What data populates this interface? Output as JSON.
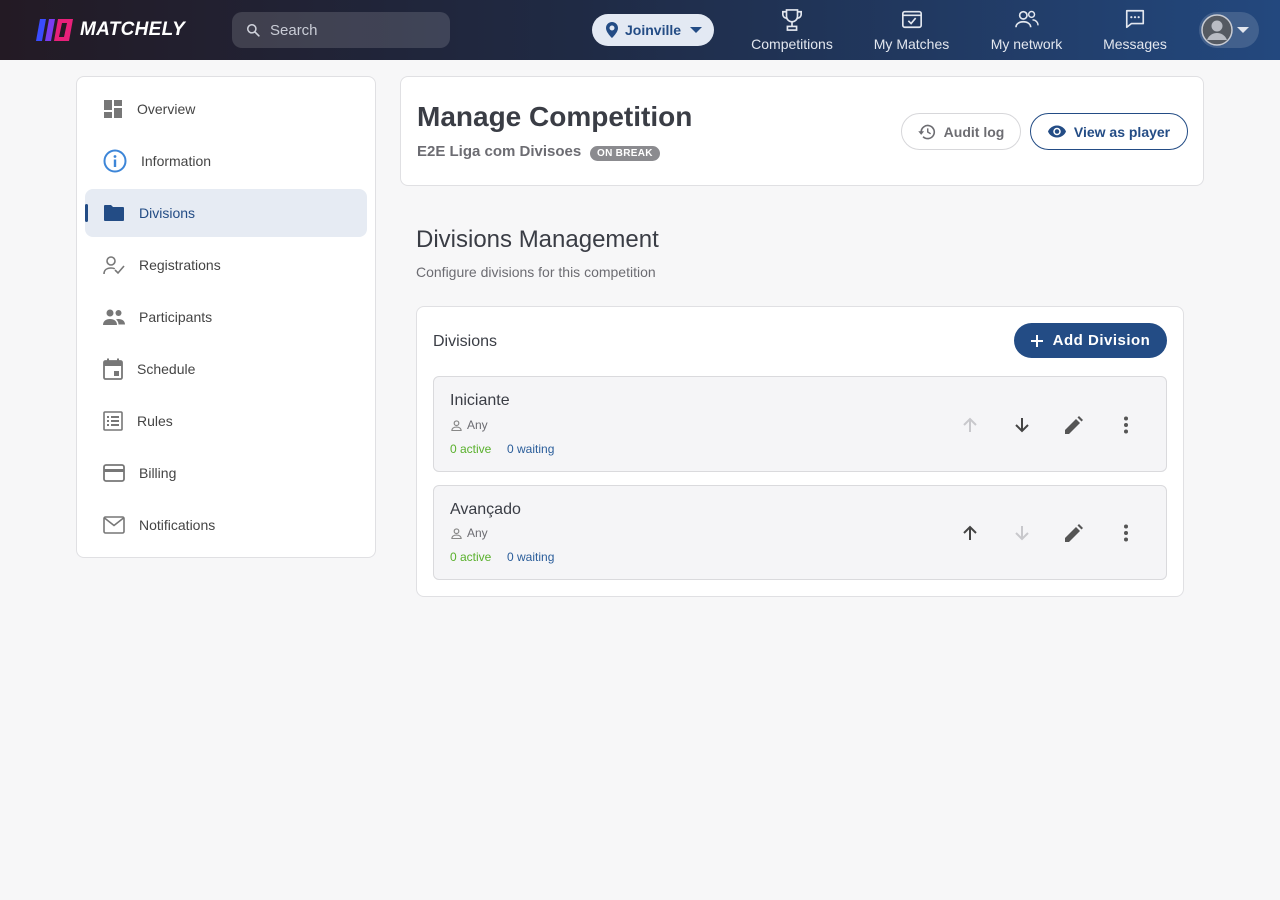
{
  "brand": {
    "name": "MATCHELY"
  },
  "search": {
    "placeholder": "Search"
  },
  "location": {
    "label": "Joinville"
  },
  "nav": {
    "competitions": "Competitions",
    "my_matches": "My Matches",
    "my_network": "My network",
    "messages": "Messages"
  },
  "sidebar": {
    "items": [
      {
        "label": "Overview",
        "icon": "dashboard-icon"
      },
      {
        "label": "Information",
        "icon": "info-icon"
      },
      {
        "label": "Divisions",
        "icon": "folder-icon",
        "active": true
      },
      {
        "label": "Registrations",
        "icon": "person-check-icon"
      },
      {
        "label": "Participants",
        "icon": "people-icon"
      },
      {
        "label": "Schedule",
        "icon": "calendar-icon"
      },
      {
        "label": "Rules",
        "icon": "list-icon"
      },
      {
        "label": "Billing",
        "icon": "credit-card-icon"
      },
      {
        "label": "Notifications",
        "icon": "mail-icon"
      }
    ]
  },
  "header": {
    "title": "Manage Competition",
    "competition_name": "E2E Liga com Divisoes",
    "status_badge": "ON BREAK",
    "audit_label": "Audit log",
    "view_as_player_label": "View as player"
  },
  "section": {
    "title": "Divisions Management",
    "description": "Configure divisions for this competition"
  },
  "divisions_card": {
    "title": "Divisions",
    "add_label": "Add Division",
    "rows": [
      {
        "name": "Iniciante",
        "gender": "Any",
        "active": "0 active",
        "waiting": "0 waiting",
        "can_move_up": false,
        "can_move_down": true
      },
      {
        "name": "Avançado",
        "gender": "Any",
        "active": "0 active",
        "waiting": "0 waiting",
        "can_move_up": true,
        "can_move_down": false
      }
    ]
  },
  "colors": {
    "primary": "#234c85",
    "active_green": "#59b02c",
    "waiting_blue": "#2a5d9a",
    "badge_gray": "#8b8b8f"
  }
}
